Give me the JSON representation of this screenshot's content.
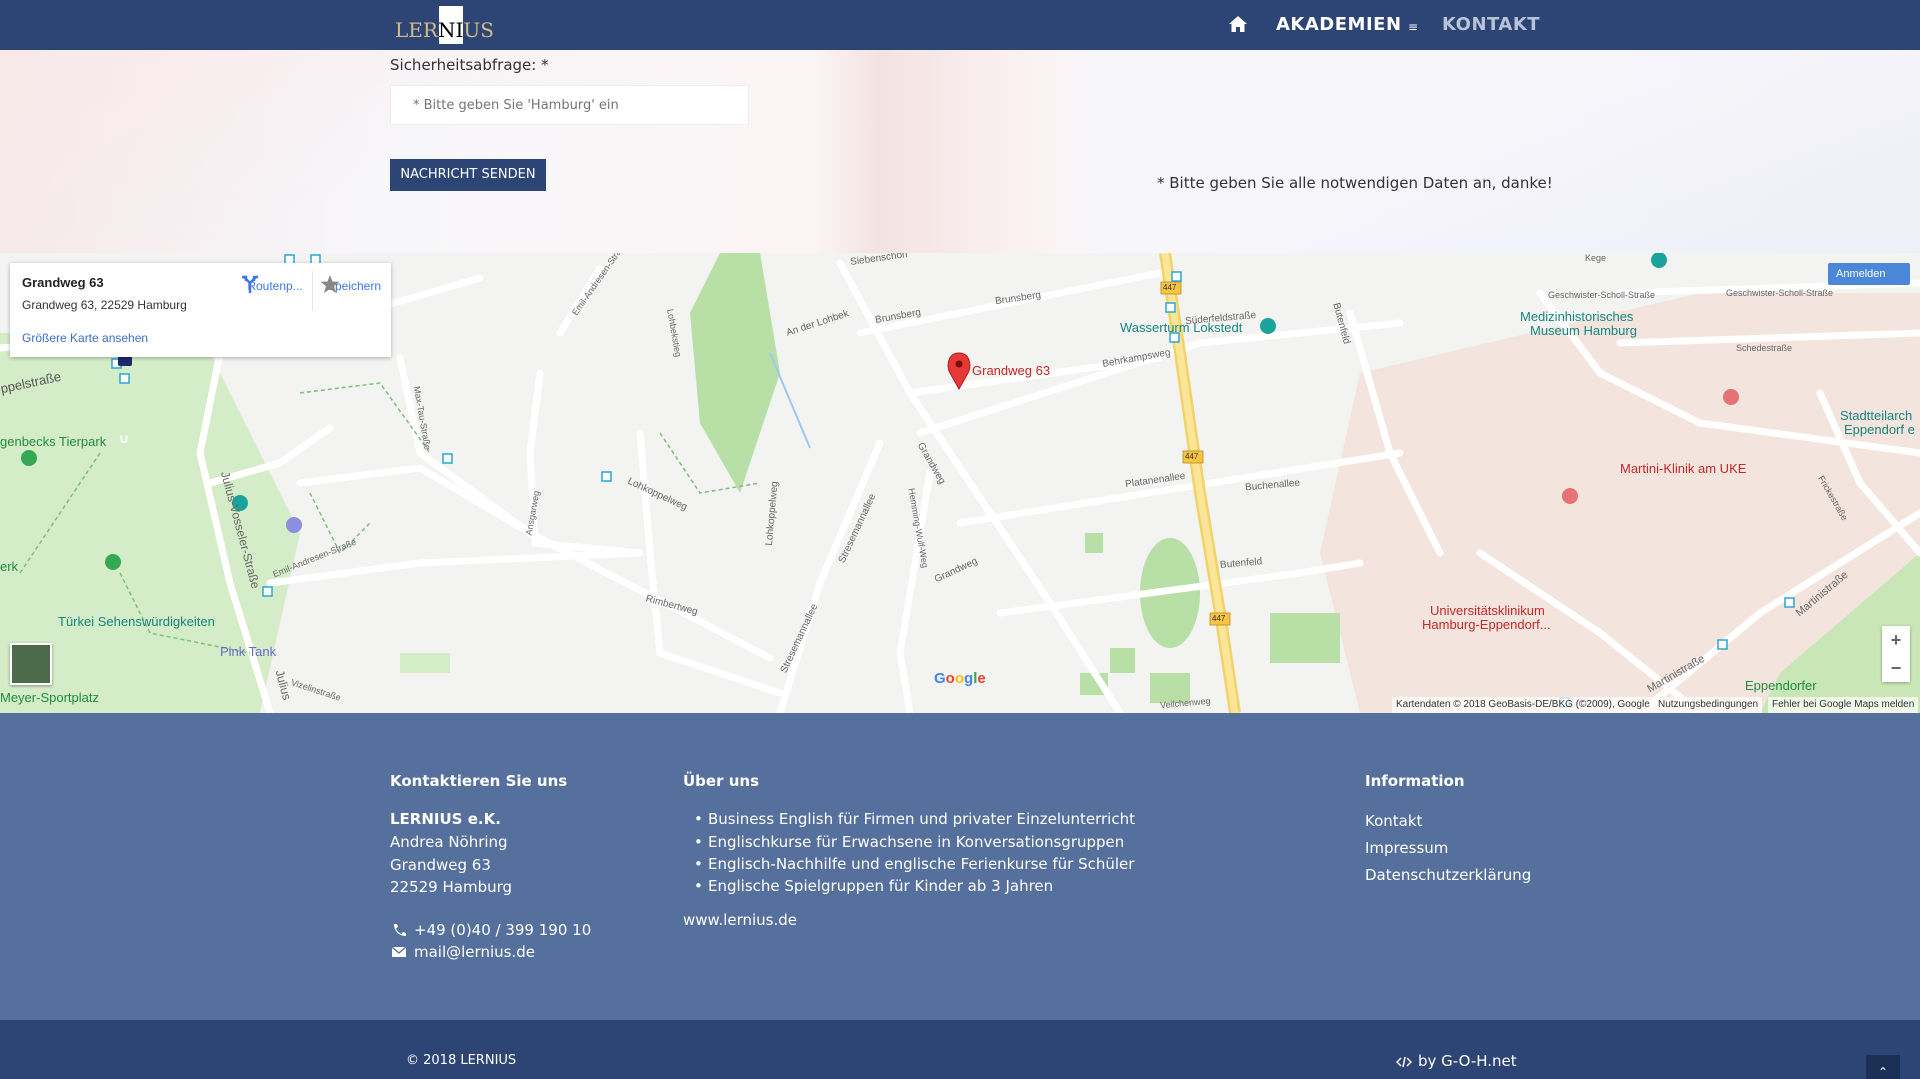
{
  "nav": {
    "logo_text": "LERNIUS",
    "akademien": "AKADEMIEN",
    "akademien_menu_glyph": "≡",
    "kontakt": "KONTAKT"
  },
  "form": {
    "security_label": "Sicherheitsabfrage: *",
    "security_placeholder": "* Bitte geben Sie 'Hamburg' ein",
    "send_button": "NACHRICHT SENDEN",
    "required_note": "* Bitte geben Sie alle notwendigen Daten an, danke!"
  },
  "map": {
    "info_title": "Grandweg 63",
    "info_address": "Grandweg 63, 22529 Hamburg",
    "route_label": "Routenp...",
    "save_label": "Speichern",
    "larger_map_link": "Größere Karte ansehen",
    "sign_in": "Anmelden",
    "marker_label": "Grandweg 63",
    "google_logo": "Google",
    "attribution": "Kartendaten © 2018 GeoBasis-DE/BKG (©2009), Google",
    "terms": "Nutzungsbedingungen",
    "report": "Fehler bei Google Maps melden",
    "zoom_in": "+",
    "zoom_out": "−",
    "labels": {
      "siebenschon": "Siebenschon",
      "emil_andresen": "Emil-Andresen-Straße",
      "emil_andresen2": "Emil-Andresen-Straße",
      "an_der_lohbek": "An der Lohbek",
      "brunsberg": "Brunsberg",
      "brunsberg2": "Brunsberg",
      "suederfeld": "Süderfeldstraße",
      "behrkamps": "Behrkampsweg",
      "wasserturm": "Wasserturm Lokstedt",
      "platanen": "Platanenallee",
      "buchen": "Buchenallee",
      "butenfeld": "Butenfeld",
      "butenfeld2": "Butenfeld",
      "grandweg": "Grandweg",
      "grandweg2": "Grandweg",
      "lohkoppel": "Lohkoppelweg",
      "lohkoppel2": "Lohkoppelweg",
      "rimbert": "Rimbertweg",
      "stresemann": "Stresemannallee",
      "stresemann2": "Stresemannallee",
      "hemming": "Hemming-Wulf-Weg",
      "ansgar": "Ansgarweg",
      "julius": "Julius-Vosseler-Straße",
      "julius2": "Julius",
      "vizelin": "Vizelinstraße",
      "max_tau": "Max-Tau-Straße",
      "lohbeksteg": "Lohbekstieg",
      "koppel": "ppelstraße",
      "tierpark": "genbecks Tierpark",
      "tuerkei": "Türkei Sehenswürdigkeiten",
      "pinktank": "Pink Tank",
      "meyer": "Meyer-Sportplatz",
      "erk": "erk",
      "geschwister": "Geschwister-Scholl-Straße",
      "geschwister2": "Geschwister-Scholl-Straße",
      "schedestr": "Schedestraße",
      "medmuseum1": "Medizinhistorisches",
      "medmuseum2": "Museum Hamburg",
      "stadtteil1": "Stadtteilarch",
      "stadtteil2": "Eppendorf e",
      "martini": "Martini-Klinik am UKE",
      "uke1": "Universitätsklinikum",
      "uke2": "Hamburg-Eppendorf...",
      "eppendorfer": "Eppendorfer",
      "martinistr": "Martinistraße",
      "martinistr2": "Martinistraße",
      "frickestr": "Frickestraße",
      "kege": "Kege",
      "veilchen": "Veilchenweg",
      "road447": "447",
      "subway": "U"
    }
  },
  "footer": {
    "col1_heading": "Kontaktieren Sie uns",
    "company": "LERNIUS e.K.",
    "person": "Andrea Nöhring",
    "street": "Grandweg 63",
    "city": "22529 Hamburg",
    "phone": "+49 (0)40 / 399 190 10",
    "email": "mail@lernius.de",
    "col2_heading": "Über uns",
    "about_items": [
      "Business English für Firmen und privater Einzelunterricht",
      "Englischkurse für Erwachsene in Konversationsgruppen",
      "Englisch-Nachhilfe und englische Ferienkurse für Schüler",
      "Englische Spielgruppen für Kinder ab 3 Jahren"
    ],
    "website": "www.lernius.de",
    "col3_heading": "Information",
    "info_links": [
      "Kontakt",
      "Impressum",
      "Datenschutzerklärung"
    ]
  },
  "bottom": {
    "copyright": "© 2018 LERNIUS",
    "byline": "by G-O-H.net",
    "to_top": "⌃"
  }
}
